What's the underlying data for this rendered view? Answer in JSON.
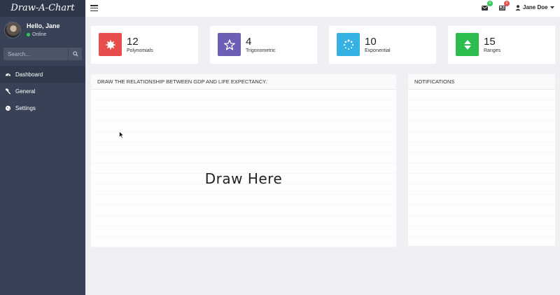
{
  "brand": "Draw-A-Chart",
  "user": {
    "greeting": "Hello, Jane",
    "status": "Online",
    "name": "Jane Doe"
  },
  "search": {
    "placeholder": "Search..."
  },
  "sidebar": {
    "items": [
      {
        "label": "Dashboard",
        "icon": "dashboard-icon",
        "active": true
      },
      {
        "label": "General",
        "icon": "wrench-icon",
        "active": false
      },
      {
        "label": "Settings",
        "icon": "globe-icon",
        "active": false
      }
    ]
  },
  "topbar": {
    "messages_badge": "0",
    "news_badge": "0"
  },
  "cards": [
    {
      "value": "12",
      "label": "Polynomials",
      "color": "#e84d4d",
      "icon": "gear-icon"
    },
    {
      "value": "4",
      "label": "Trigonometric",
      "color": "#6c5fb6",
      "icon": "star-icon"
    },
    {
      "value": "10",
      "label": "Exponential",
      "color": "#36b1e3",
      "icon": "spinner-icon"
    },
    {
      "value": "15",
      "label": "Ranges",
      "color": "#2dbd4e",
      "icon": "sort-icon"
    }
  ],
  "draw_panel": {
    "title": "DRAW THE RELATIONSHIP BETWEEN GDP AND LIFE EXPECTANCY.",
    "placeholder": "Draw Here"
  },
  "notifications_panel": {
    "title": "NOTIFICATIONS"
  }
}
